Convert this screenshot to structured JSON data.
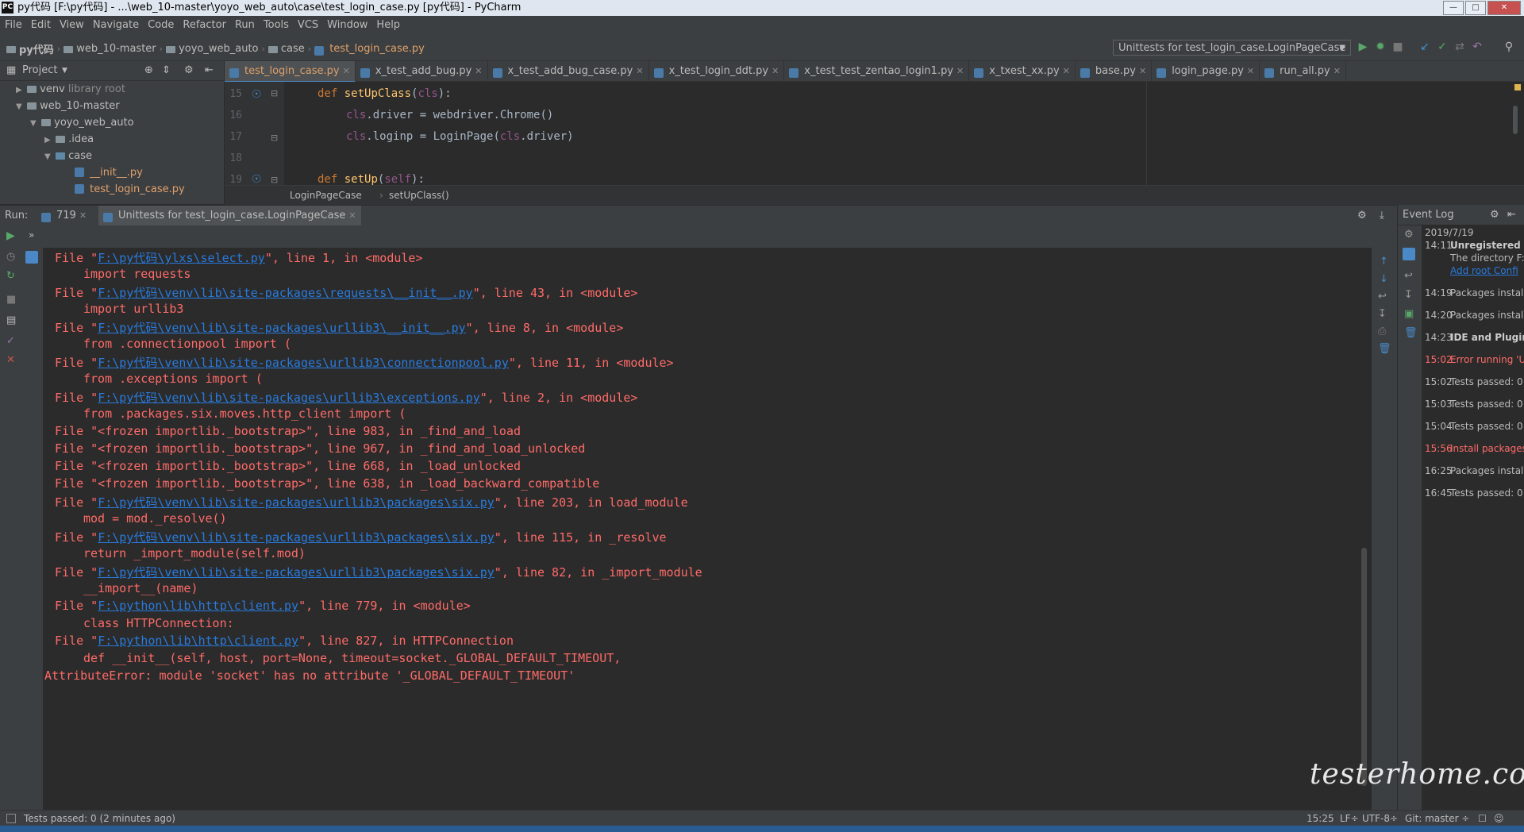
{
  "window": {
    "title": "py代码 [F:\\py代码] - ...\\web_10-master\\yoyo_web_auto\\case\\test_login_case.py [py代码] - PyCharm",
    "app_icon": "PC"
  },
  "menu": [
    "File",
    "Edit",
    "View",
    "Navigate",
    "Code",
    "Refactor",
    "Run",
    "Tools",
    "VCS",
    "Window",
    "Help"
  ],
  "breadcrumb": [
    "py代码",
    "web_10-master",
    "yoyo_web_auto",
    "case",
    "test_login_case.py"
  ],
  "run_config": "Unittests for test_login_case.LoginPageCase",
  "project_panel": {
    "title": "Project",
    "tree": [
      {
        "label": "venv",
        "suffix": "library root",
        "indent": 1,
        "expanded": false,
        "kind": "folder"
      },
      {
        "label": "web_10-master",
        "indent": 1,
        "expanded": true,
        "kind": "folder"
      },
      {
        "label": "yoyo_web_auto",
        "indent": 2,
        "expanded": true,
        "kind": "folder"
      },
      {
        "label": ".idea",
        "indent": 3,
        "expanded": false,
        "kind": "folder"
      },
      {
        "label": "case",
        "indent": 3,
        "expanded": true,
        "kind": "folder"
      },
      {
        "label": "__init__.py",
        "indent": 4,
        "kind": "py"
      },
      {
        "label": "test_login_case.py",
        "indent": 4,
        "kind": "py"
      }
    ]
  },
  "editor_tabs": [
    {
      "label": "test_login_case.py",
      "active": true
    },
    {
      "label": "x_test_add_bug.py",
      "active": false
    },
    {
      "label": "x_test_add_bug_case.py",
      "active": false
    },
    {
      "label": "x_test_login_ddt.py",
      "active": false
    },
    {
      "label": "x_test_test_zentao_login1.py",
      "active": false
    },
    {
      "label": "x_txest_xx.py",
      "active": false
    },
    {
      "label": "base.py",
      "active": false
    },
    {
      "label": "login_page.py",
      "active": false
    },
    {
      "label": "run_all.py",
      "active": false
    }
  ],
  "code": {
    "line_numbers": [
      "15",
      "16",
      "17",
      "18",
      "19"
    ],
    "line15": {
      "kw": "def",
      "fn": "setUpClass",
      "open": "(",
      "self": "cls",
      "close": "):"
    },
    "line16": {
      "self": "cls",
      "rest": ".driver = webdriver.Chrome()"
    },
    "line17": {
      "self": "cls",
      "mid": ".loginp = LoginPage(",
      "self2": "cls",
      "rest": ".driver)"
    },
    "line19": {
      "kw": "def",
      "fn": "setUp",
      "open": "(",
      "self": "self",
      "close": "):"
    }
  },
  "editor_crumbs": [
    "LoginPageCase",
    "setUpClass()"
  ],
  "run_panel": {
    "label": "Run:",
    "tabs": [
      "719",
      "Unittests for test_login_case.LoginPageCase"
    ]
  },
  "console": [
    {
      "pre": "File \"",
      "link": "F:\\py代码\\ylxs\\select.py",
      "post": "\", line 1, in <module>",
      "indent": false
    },
    {
      "text": "import requests",
      "indent": true
    },
    {
      "pre": "File \"",
      "link": "F:\\py代码\\venv\\lib\\site-packages\\requests\\__init__.py",
      "post": "\", line 43, in <module>",
      "indent": false
    },
    {
      "text": "import urllib3",
      "indent": true
    },
    {
      "pre": "File \"",
      "link": "F:\\py代码\\venv\\lib\\site-packages\\urllib3\\__init__.py",
      "post": "\", line 8, in <module>",
      "indent": false
    },
    {
      "text": "from .connectionpool import (",
      "indent": true
    },
    {
      "pre": "File \"",
      "link": "F:\\py代码\\venv\\lib\\site-packages\\urllib3\\connectionpool.py",
      "post": "\", line 11, in <module>",
      "indent": false
    },
    {
      "text": "from .exceptions import (",
      "indent": true
    },
    {
      "pre": "File \"",
      "link": "F:\\py代码\\venv\\lib\\site-packages\\urllib3\\exceptions.py",
      "post": "\", line 2, in <module>",
      "indent": false
    },
    {
      "text": "from .packages.six.moves.http_client import (",
      "indent": true
    },
    {
      "text": "File \"<frozen importlib._bootstrap>\", line 983, in _find_and_load",
      "indent": false
    },
    {
      "text": "File \"<frozen importlib._bootstrap>\", line 967, in _find_and_load_unlocked",
      "indent": false
    },
    {
      "text": "File \"<frozen importlib._bootstrap>\", line 668, in _load_unlocked",
      "indent": false
    },
    {
      "text": "File \"<frozen importlib._bootstrap>\", line 638, in _load_backward_compatible",
      "indent": false
    },
    {
      "pre": "File \"",
      "link": "F:\\py代码\\venv\\lib\\site-packages\\urllib3\\packages\\six.py",
      "post": "\", line 203, in load_module",
      "indent": false
    },
    {
      "text": "mod = mod._resolve()",
      "indent": true
    },
    {
      "pre": "File \"",
      "link": "F:\\py代码\\venv\\lib\\site-packages\\urllib3\\packages\\six.py",
      "post": "\", line 115, in _resolve",
      "indent": false
    },
    {
      "text": "return _import_module(self.mod)",
      "indent": true
    },
    {
      "pre": "File \"",
      "link": "F:\\py代码\\venv\\lib\\site-packages\\urllib3\\packages\\six.py",
      "post": "\", line 82, in _import_module",
      "indent": false
    },
    {
      "text": "__import__(name)",
      "indent": true
    },
    {
      "pre": "File \"",
      "link": "F:\\python\\lib\\http\\client.py",
      "post": "\", line 779, in <module>",
      "indent": false
    },
    {
      "text": "class HTTPConnection:",
      "indent": true
    },
    {
      "pre": "File \"",
      "link": "F:\\python\\lib\\http\\client.py",
      "post": "\", line 827, in HTTPConnection",
      "indent": false
    },
    {
      "text": "def __init__(self, host, port=None, timeout=socket._GLOBAL_DEFAULT_TIMEOUT,",
      "indent": true
    },
    {
      "text": "AttributeError: module 'socket' has no attribute '_GLOBAL_DEFAULT_TIMEOUT'",
      "indent": false,
      "outdent": true
    }
  ],
  "event_log": {
    "title": "Event Log",
    "date": "2019/7/19",
    "entries": [
      {
        "time": "14:11",
        "text": "Unregistered",
        "style": "bold"
      },
      {
        "time": "",
        "text": "The directory F:",
        "style": "plain"
      },
      {
        "time": "",
        "text": "Add root  Confi",
        "style": "link"
      },
      {
        "time": "14:19",
        "text": "Packages install",
        "style": "plain"
      },
      {
        "time": "14:20",
        "text": "Packages install",
        "style": "plain"
      },
      {
        "time": "14:23",
        "text": "IDE and Plugin",
        "style": "bold"
      },
      {
        "time": "15:02",
        "text": "Error running 'U",
        "style": "err"
      },
      {
        "time": "15:02",
        "text": "Tests passed: 0",
        "style": "plain"
      },
      {
        "time": "15:03",
        "text": "Tests passed: 0",
        "style": "plain"
      },
      {
        "time": "15:04",
        "text": "Tests passed: 0",
        "style": "plain"
      },
      {
        "time": "15:56",
        "text": "Install packages",
        "style": "err"
      },
      {
        "time": "16:25",
        "text": "Packages install",
        "style": "plain"
      },
      {
        "time": "16:45",
        "text": "Tests passed: 0",
        "style": "plain"
      }
    ]
  },
  "status": {
    "left": "Tests passed: 0 (2 minutes ago)",
    "position": "15:25",
    "line_sep": "LF÷",
    "encoding": "UTF-8÷",
    "git": "Git: master ÷"
  },
  "watermark": "testerhome.com",
  "colors": {
    "error": "#ff6b68",
    "link": "#287bde",
    "accent": "#4a88c7"
  }
}
